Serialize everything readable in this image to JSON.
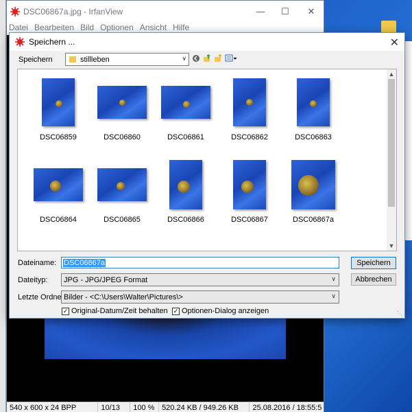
{
  "irfanview": {
    "title": "DSC06867a.jpg - IrfanView",
    "menu": [
      "Datei",
      "Bearbeiten",
      "Bild",
      "Optionen",
      "Ansicht",
      "Hilfe"
    ],
    "status": {
      "dimensions": "540 x 600 x 24 BPP",
      "index": "10/13",
      "zoom": "100 %",
      "size": "520.24 KB / 949.26 KB",
      "datetime": "25.08.2016 / 18:55:5"
    }
  },
  "dialog": {
    "title": "Speichern ...",
    "save_in_label": "Speichern",
    "location": "stillleben",
    "files": [
      {
        "name": "DSC06859"
      },
      {
        "name": "DSC06860"
      },
      {
        "name": "DSC06861"
      },
      {
        "name": "DSC06862"
      },
      {
        "name": "DSC06863"
      },
      {
        "name": "DSC06864"
      },
      {
        "name": "DSC06865"
      },
      {
        "name": "DSC06866"
      },
      {
        "name": "DSC06867"
      },
      {
        "name": "DSC06867a"
      },
      {
        "name": ""
      },
      {
        "name": ""
      },
      {
        "name": ""
      }
    ],
    "filename_label": "Dateiname:",
    "filename_value": "DSC06867a",
    "filetype_label": "Dateityp:",
    "filetype_value": "JPG - JPG/JPEG Format",
    "recent_label": "Letzte Ordner:",
    "recent_value": "Bilder -  <C:\\Users\\Walter\\Pictures\\>",
    "save_button": "Speichern",
    "cancel_button": "Abbrechen",
    "checkbox_original_date": "Original-Datum/Zeit behalten",
    "checkbox_options_dialog": "Optionen-Dialog anzeigen",
    "checkbox_original_date_checked": true,
    "checkbox_options_dialog_checked": true
  },
  "colors": {
    "selection": "#3399ff",
    "default_button_border": "#0078d7",
    "photo_blue": "#2d64d8"
  }
}
